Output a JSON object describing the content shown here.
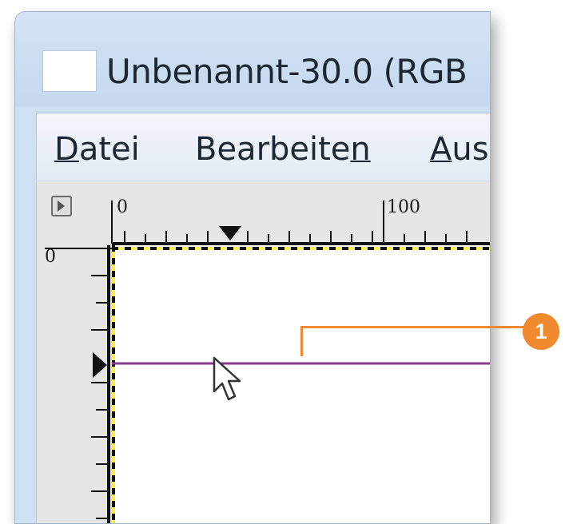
{
  "window": {
    "title": "Unbenannt-30.0 (RGB",
    "icon": "image-icon"
  },
  "menubar": {
    "items": [
      {
        "pre": "",
        "ul": "D",
        "post": "atei"
      },
      {
        "pre": "Bearbeite",
        "ul": "n",
        "post": ""
      },
      {
        "pre": "",
        "ul": "A",
        "post": "us"
      }
    ]
  },
  "rulers": {
    "horizontal_labels": [
      "0",
      "100"
    ],
    "vertical_labels": [
      "0"
    ]
  },
  "guide": {
    "color": "#8a3a8f"
  },
  "selection": {
    "border_color": "#f1ef5a"
  },
  "callout": {
    "number": "1",
    "color": "#f08a2e"
  },
  "icons": {
    "nav": "navigate-icon",
    "cursor": "mouse-pointer-icon"
  }
}
